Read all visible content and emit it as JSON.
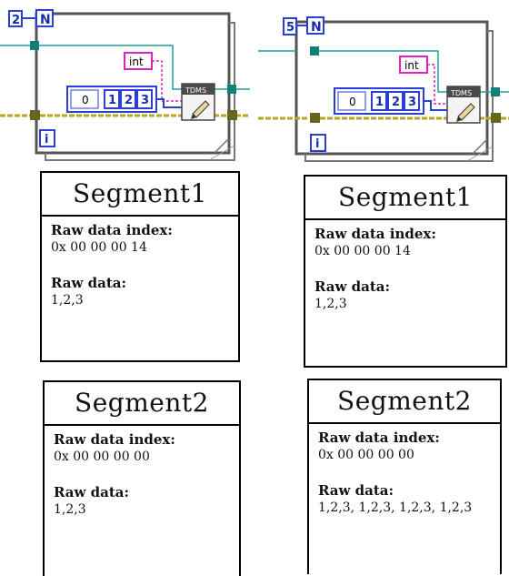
{
  "left": {
    "loop_count": "2",
    "loop_terminal": "N",
    "iteration_terminal": "i",
    "constant_label": "int",
    "array_index": "0",
    "array_values": [
      "1",
      "2",
      "3"
    ],
    "tdms_label": "TDMS",
    "segments": [
      {
        "title": "Segment1",
        "index_label": "Raw data index:",
        "index_value": "0x 00 00 00 14",
        "data_label": "Raw data:",
        "data_value": "1,2,3"
      },
      {
        "title": "Segment2",
        "index_label": "Raw data index:",
        "index_value": "0x 00 00 00 00",
        "data_label": "Raw data:",
        "data_value": "1,2,3"
      }
    ]
  },
  "right": {
    "loop_count": "5",
    "loop_terminal": "N",
    "iteration_terminal": "i",
    "constant_label": "int",
    "array_index": "0",
    "array_values": [
      "1",
      "2",
      "3"
    ],
    "tdms_label": "TDMS",
    "segments": [
      {
        "title": "Segment1",
        "index_label": "Raw data index:",
        "index_value": "0x 00 00 00 14",
        "data_label": "Raw data:",
        "data_value": "1,2,3"
      },
      {
        "title": "Segment2",
        "index_label": "Raw data index:",
        "index_value": "0x 00 00 00 00",
        "data_label": "Raw data:",
        "data_value": "1,2,3, 1,2,3, 1,2,3, 1,2,3"
      }
    ]
  }
}
